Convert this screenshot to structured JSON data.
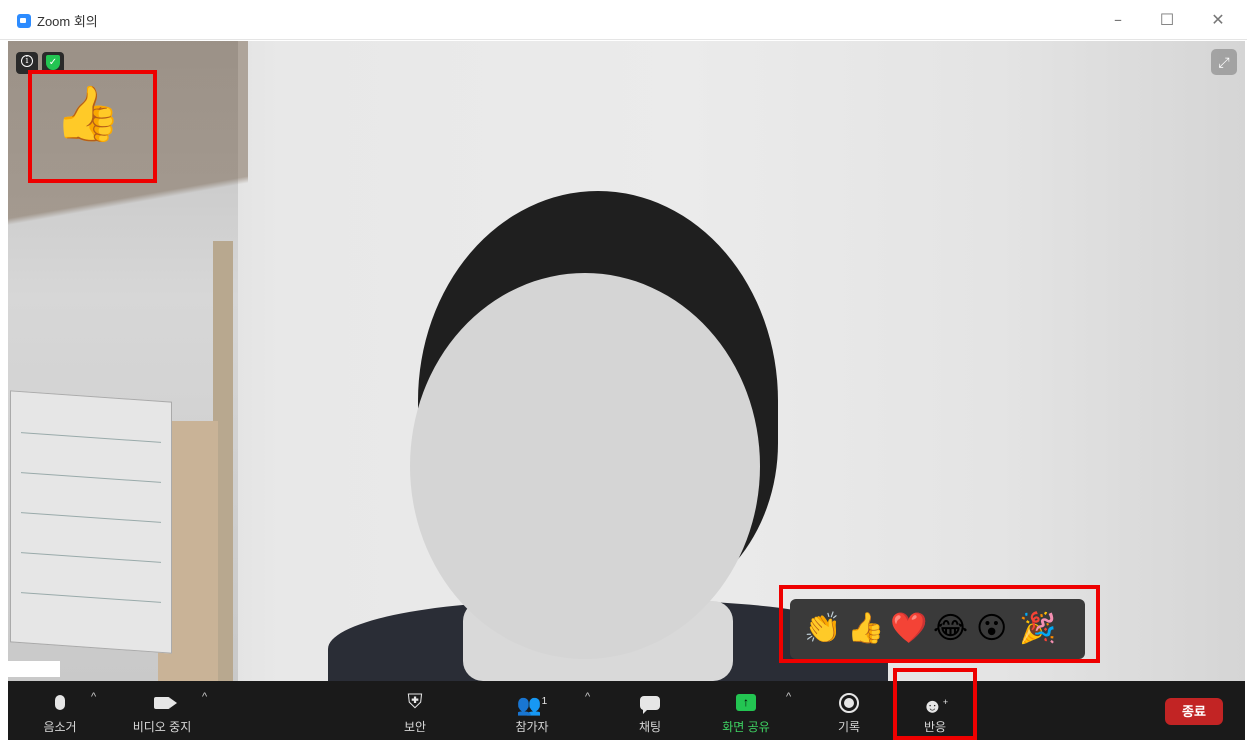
{
  "window": {
    "title": "Zoom 회의",
    "controls": [
      "–",
      "☐",
      "✕"
    ]
  },
  "video": {
    "reaction_shown": "👍",
    "expand_glyph": "⤢"
  },
  "reaction_picker": {
    "emojis": [
      "👏",
      "👍",
      "❤️",
      "😂",
      "😮",
      "🎉"
    ]
  },
  "toolbar": {
    "mute_label": "음소거",
    "video_label": "비디오 중지",
    "security_label": "보안",
    "participants_label": "참가자",
    "participants_count": "1",
    "chat_label": "채팅",
    "share_label": "화면 공유",
    "record_label": "기록",
    "reactions_label": "반응",
    "end_label": "종료",
    "caret": "^"
  },
  "colors": {
    "highlight": "#e00000",
    "end_button": "#c22424",
    "share_green": "#23c552",
    "toolbar_bg": "#1a1a1a"
  }
}
